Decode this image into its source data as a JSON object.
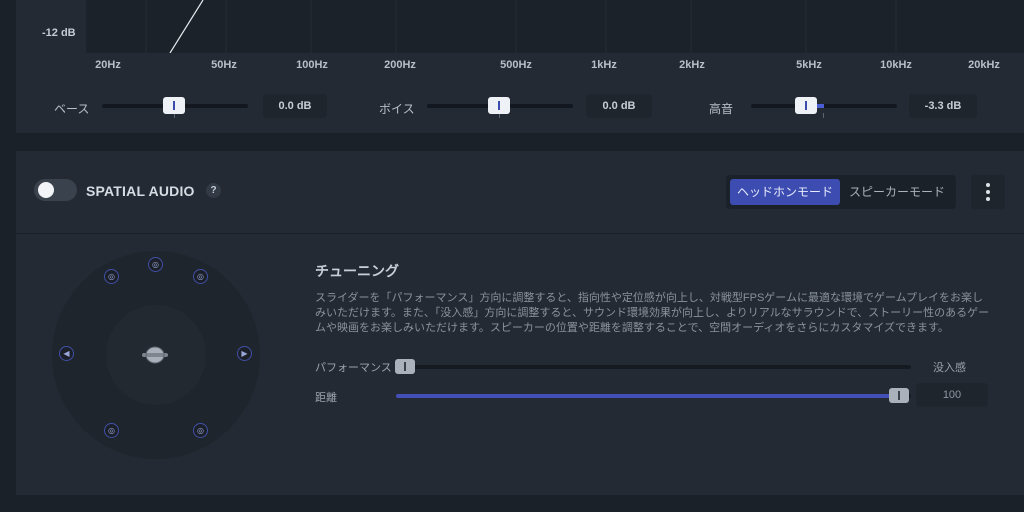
{
  "eq": {
    "db_label": "-12 dB",
    "frequencies": [
      "20Hz",
      "50Hz",
      "100Hz",
      "200Hz",
      "500Hz",
      "1kHz",
      "2kHz",
      "5kHz",
      "10kHz",
      "20kHz"
    ],
    "bands": [
      {
        "label": "ベース",
        "value": "0.0 dB",
        "level": 0.5
      },
      {
        "label": "ボイス",
        "value": "0.0 dB",
        "level": 0.5
      },
      {
        "label": "高音",
        "value": "-3.3 dB",
        "level": 0.38
      }
    ]
  },
  "spatial": {
    "title": "SPATIAL AUDIO",
    "help": "?",
    "enabled": false,
    "modes": [
      "ヘッドホンモード",
      "スピーカーモード"
    ],
    "active_mode": "ヘッドホンモード",
    "tuning": {
      "title": "チューニング",
      "description": "スライダーを「パフォーマンス」方向に調整すると、指向性や定位感が向上し、対戦型FPSゲームに最適な環境でゲームプレイをお楽しみいただけます。また、「没入感」方向に調整すると、サウンド環境効果が向上し、よりリアルなサラウンドで、ストーリー性のあるゲームや映画をお楽しみいただけます。スピーカーの位置や距離を調整することで、空間オーディオをさらにカスタマイズできます。",
      "performance_label": "パフォーマンス",
      "immersion_label": "没入感",
      "immersion_level": 0,
      "distance_label": "距離",
      "distance_value": "100",
      "distance_level": 1.0
    }
  },
  "colors": {
    "accent": "#3c4cb0",
    "panel": "#232a33",
    "background": "#1b2128"
  }
}
